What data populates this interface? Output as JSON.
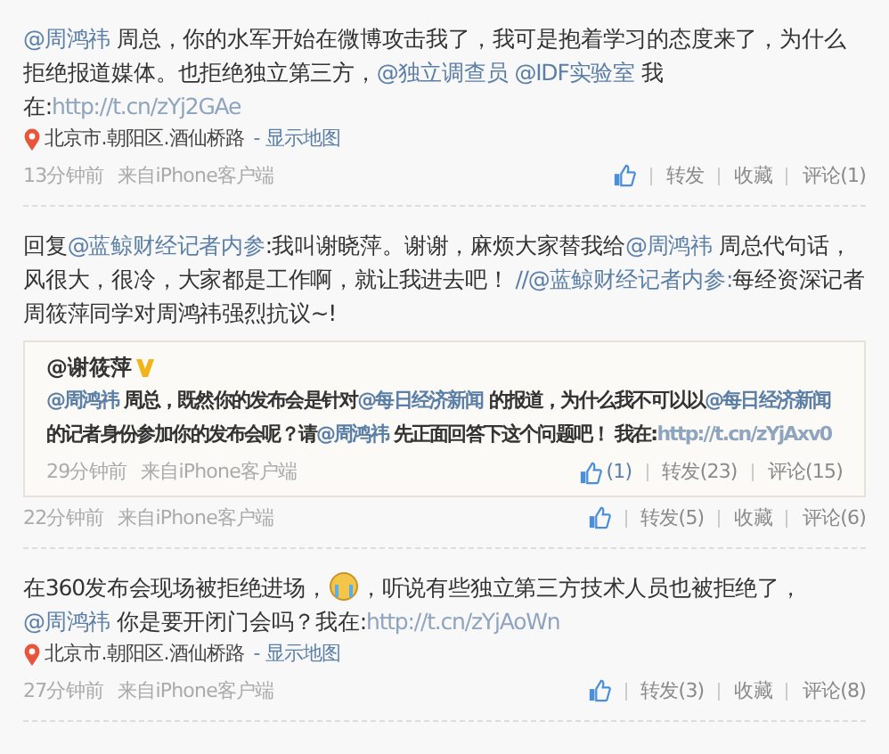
{
  "posts": [
    {
      "text": [
        {
          "kind": "mention",
          "text": "@周鸿祎"
        },
        {
          "kind": "text",
          "text": " 周总，你的水军开始在微博攻击我了，我可是抱着学习的态度来了，为什么拒绝报道媒体。也拒绝独立第三方，"
        },
        {
          "kind": "mention",
          "text": "@独立调查员 "
        },
        {
          "kind": "mention",
          "text": "@IDF实验室"
        },
        {
          "kind": "text",
          "text": " 我在:"
        },
        {
          "kind": "link",
          "text": "http://t.cn/zYj2GAe"
        }
      ],
      "location": {
        "place": "北京市.朝阳区.酒仙桥路",
        "map": "- 显示地图"
      },
      "time": "13分钟前",
      "source": "来自iPhone客户端",
      "actions": [
        "转发",
        "收藏",
        "评论(1)"
      ]
    },
    {
      "text": [
        {
          "kind": "text",
          "text": "回复"
        },
        {
          "kind": "mention",
          "text": "@蓝鲸财经记者内参"
        },
        {
          "kind": "text",
          "text": ":我叫谢晓萍。谢谢，麻烦大家替我给"
        },
        {
          "kind": "mention",
          "text": "@周鸿祎"
        },
        {
          "kind": "text",
          "text": " 周总代句话，风很大，很冷，大家都是工作啊，就让我进去吧！ "
        },
        {
          "kind": "mention",
          "text": "//@蓝鲸财经记者内参:"
        },
        {
          "kind": "text",
          "text": "每经资深记者周筱萍同学对周鸿祎强烈抗议~!"
        }
      ],
      "quote": {
        "author": "@谢筱萍",
        "verified": true,
        "text": [
          {
            "kind": "mention",
            "text": "@周鸿祎"
          },
          {
            "kind": "text",
            "text": " 周总，既然你的发布会是针对"
          },
          {
            "kind": "mention",
            "text": "@每日经济新闻"
          },
          {
            "kind": "text",
            "text": " 的报道，为什么我不可以以"
          },
          {
            "kind": "mention",
            "text": "@每日经济新闻"
          },
          {
            "kind": "text",
            "text": " 的记者身份参加你的发布会呢？请"
          },
          {
            "kind": "mention",
            "text": "@周鸿祎"
          },
          {
            "kind": "text",
            "text": " 先正面回答下这个问题吧！ 我在:"
          },
          {
            "kind": "link",
            "text": "http://t.cn/zYjAxv0"
          }
        ],
        "time": "29分钟前",
        "source": "来自iPhone客户端",
        "like_count": "(1)",
        "actions": [
          "转发(23)",
          "评论(15)"
        ]
      },
      "time": "22分钟前",
      "source": "来自iPhone客户端",
      "actions": [
        "转发(5)",
        "收藏",
        "评论(6)"
      ]
    },
    {
      "text": [
        {
          "kind": "text",
          "text": "在360发布会现场被拒绝进场，"
        },
        {
          "kind": "emoji"
        },
        {
          "kind": "text",
          "text": "，听说有些独立第三方技术人员也被拒绝了，"
        },
        {
          "kind": "mention",
          "text": "@周鸿祎"
        },
        {
          "kind": "text",
          "text": " 你是要开闭门会吗？我在:"
        },
        {
          "kind": "link",
          "text": "http://t.cn/zYjAoWn"
        }
      ],
      "location": {
        "place": "北京市.朝阳区.酒仙桥路",
        "map": "- 显示地图"
      },
      "time": "27分钟前",
      "source": "来自iPhone客户端",
      "actions": [
        "转发(3)",
        "收藏",
        "评论(8)"
      ]
    }
  ]
}
